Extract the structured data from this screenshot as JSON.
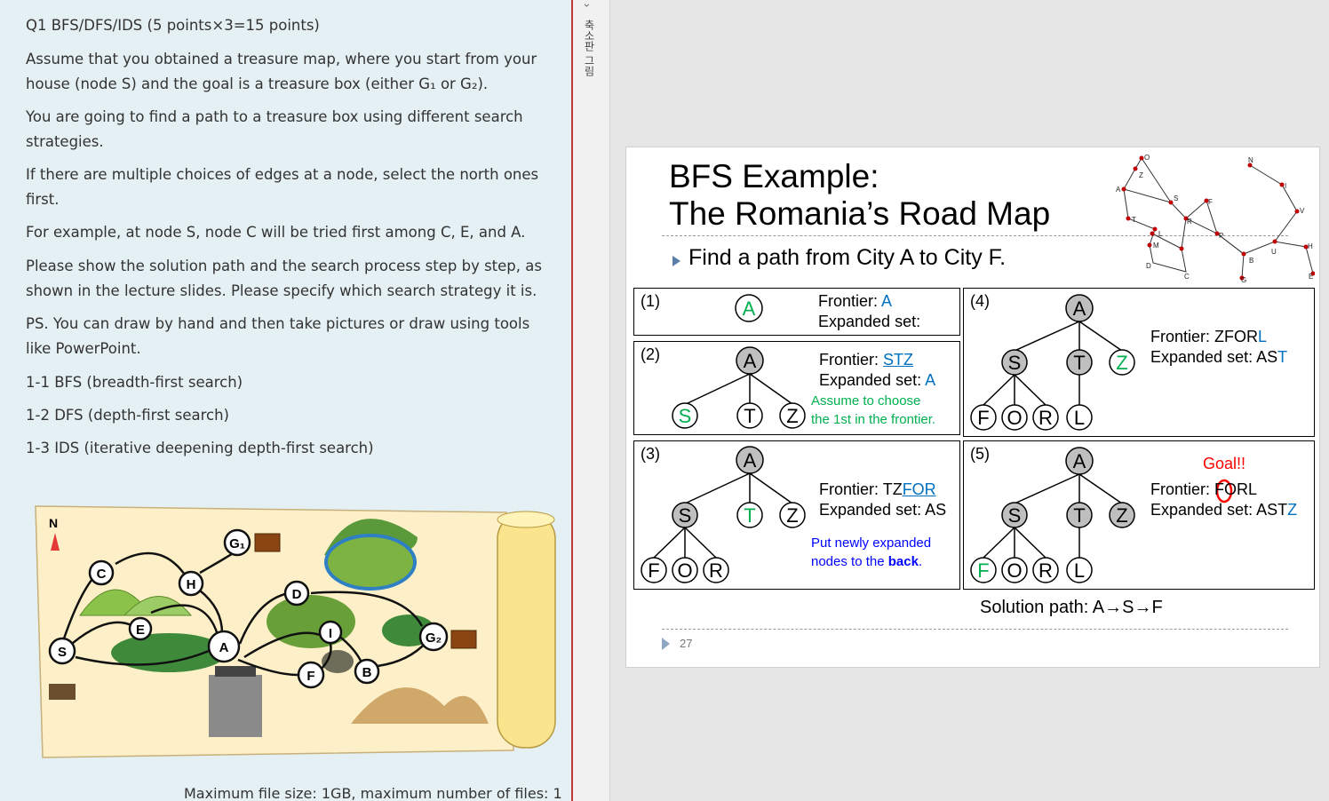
{
  "question": {
    "title": "Q1 BFS/DFS/IDS (5 points×3=15 points)",
    "p1": "Assume that you obtained a treasure map, where you start from your house (node S) and the goal is a treasure box (either G₁ or G₂).",
    "p2": "You are going to find a path to a treasure box using different search strategies.",
    "p3": "If there are multiple choices of edges at a node, select the north ones first.",
    "p4": "For example, at node S, node C will be tried first among C, E, and A.",
    "p5": "Please show the solution path and the search process step by step, as shown in the lecture slides. Please specify which search strategy it is.",
    "p6": "PS. You can draw by hand and then take pictures or draw using tools like PowerPoint.",
    "item1": "1-1 BFS (breadth-first search)",
    "item2": "1-2 DFS (depth-first search)",
    "item3": "1-3 IDS (iterative deepening depth-first search)",
    "footer": "Maximum file size: 1GB, maximum number of files: 1"
  },
  "map": {
    "north": "N",
    "nodes": [
      "S",
      "C",
      "E",
      "H",
      "A",
      "D",
      "I",
      "F",
      "B"
    ],
    "goal1": "G₁",
    "goal2": "G₂"
  },
  "sidebar": {
    "label": "축소판 그림",
    "toggle": "›"
  },
  "slide": {
    "title_line1": "BFS Example:",
    "title_line2": "The Romania’s Road Map",
    "bullet": "Find a path from City A to City F.",
    "page_number": "27",
    "romania_cities": [
      "O",
      "Z",
      "A",
      "T",
      "S",
      "R",
      "F",
      "L",
      "M",
      "D",
      "P",
      "C",
      "B",
      "G",
      "U",
      "N",
      "I",
      "V",
      "H",
      "E"
    ],
    "panel1": {
      "num": "(1)",
      "frontier_label": "Frontier: ",
      "frontier": "A",
      "expanded_label": "Expanded set:"
    },
    "panel2": {
      "num": "(2)",
      "frontier_label": "Frontier: ",
      "frontier": "STZ",
      "expanded_label": "Expanded set: ",
      "expanded": "A",
      "note1": "Assume to choose",
      "note2": "the 1st in the frontier."
    },
    "panel3": {
      "num": "(3)",
      "frontier_label": "Frontier: TZ",
      "frontier": "FOR",
      "expanded_label": "Expanded set: AS",
      "note1": "Put newly expanded",
      "note2a": "nodes to the ",
      "note2b": "back",
      "note2c": "."
    },
    "panel4": {
      "num": "(4)",
      "frontier_label": "Frontier: ZFOR",
      "frontier": "L",
      "expanded_label": "Expanded set: AS",
      "expanded": "T"
    },
    "panel5": {
      "num": "(5)",
      "goal": "Goal!!",
      "frontier_label": "Frontier: ",
      "frontier": "FORL",
      "expanded_label": "Expanded set: AST",
      "expanded": "Z"
    },
    "solution": "Solution path: A→S→F"
  },
  "colors": {
    "left_bg": "#e4f0f3",
    "accent_red": "#c0393b",
    "blue": "#0070c0",
    "green": "#00b050",
    "node_gray": "#bfbfbf"
  }
}
